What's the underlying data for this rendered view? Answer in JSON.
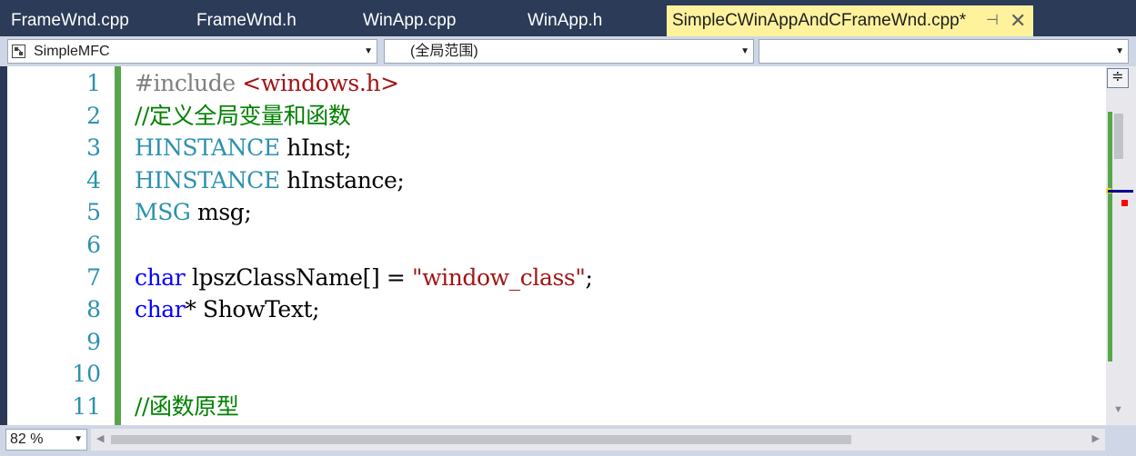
{
  "tabs": [
    {
      "label": "FrameWnd.cpp",
      "active": false
    },
    {
      "label": "FrameWnd.h",
      "active": false
    },
    {
      "label": "WinApp.cpp",
      "active": false
    },
    {
      "label": "WinApp.h",
      "active": false
    },
    {
      "label": "SimpleCWinAppAndCFrameWnd.cpp*",
      "active": true
    }
  ],
  "tab_icons": {
    "pin": "pin-icon",
    "close": "close-icon"
  },
  "navbar": {
    "project": "SimpleMFC",
    "scope": "(全局范围)",
    "member": ""
  },
  "editor": {
    "line_numbers": [
      "1",
      "2",
      "3",
      "4",
      "5",
      "6",
      "7",
      "8",
      "9",
      "10",
      "11"
    ],
    "lines": [
      [
        {
          "t": "#include ",
          "c": "pp"
        },
        {
          "t": "<windows.h>",
          "c": "inc"
        }
      ],
      [
        {
          "t": "//定义全局变量和函数",
          "c": "cm"
        }
      ],
      [
        {
          "t": "HINSTANCE",
          "c": "ty"
        },
        {
          "t": " hInst;",
          "c": ""
        }
      ],
      [
        {
          "t": "HINSTANCE",
          "c": "ty"
        },
        {
          "t": " hInstance;",
          "c": ""
        }
      ],
      [
        {
          "t": "MSG",
          "c": "ty"
        },
        {
          "t": " msg;",
          "c": ""
        }
      ],
      [],
      [
        {
          "t": "char",
          "c": "kw"
        },
        {
          "t": " lpszClassName[] = ",
          "c": ""
        },
        {
          "t": "\"window_class\"",
          "c": "st"
        },
        {
          "t": ";",
          "c": ""
        }
      ],
      [
        {
          "t": "char",
          "c": "kw"
        },
        {
          "t": "* ShowText;",
          "c": ""
        }
      ],
      [],
      [],
      [
        {
          "t": "//函数原型",
          "c": "cm"
        }
      ]
    ]
  },
  "zoom": {
    "value": "82 %"
  },
  "colors": {
    "tab_bar": "#2b3b58",
    "active_tab": "#fff29d",
    "change_margin": "#57a64a",
    "line_number": "#2b91af",
    "keyword": "#0000ff",
    "type": "#2b91af",
    "comment": "#008000",
    "string": "#a31515"
  }
}
